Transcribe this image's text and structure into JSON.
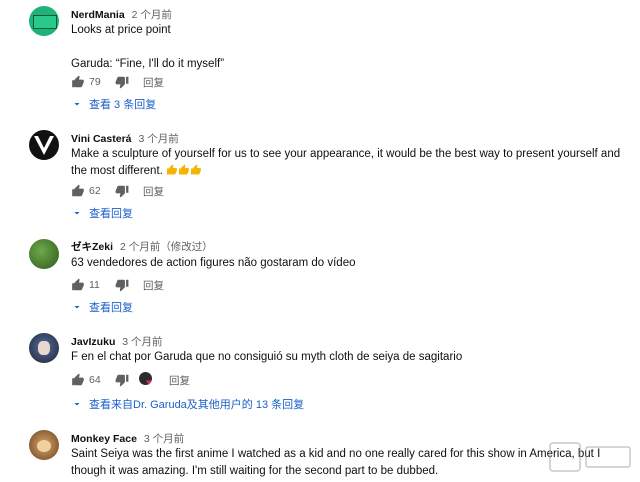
{
  "comments": [
    {
      "author": "NerdMania",
      "time": "2 个月前",
      "text": "Looks at price point\n\nGaruda: “Fine, I'll do it myself”",
      "likes": "79",
      "reply": "回复",
      "replies": "查看 3 条回复",
      "avatar_color": "#1fb37a"
    },
    {
      "author": "Vini Casterá",
      "time": "3 个月前",
      "text_main": "Make a sculpture of yourself for us to see your appearance, it would be the best way to present yourself and the most different.",
      "likes": "62",
      "reply": "回复",
      "replies": "查看回复",
      "avatar_color": "#111111"
    },
    {
      "author": "ゼキZeki",
      "time": "2 个月前（修改过）",
      "text": "63 vendedores de action figures não gostaram do vídeo",
      "likes": "11",
      "reply": "回复",
      "replies": "查看回复",
      "avatar_color": "#3f7a2d"
    },
    {
      "author": "JavIzuku",
      "time": "3 个月前",
      "text": "F en el chat por Garuda que no consiguió su myth cloth de seiya de sagitario",
      "likes": "64",
      "reply": "回复",
      "replies": "查看来自Dr. Garuda及其他用户的 13 条回复",
      "avatar_color": "#2a3550"
    },
    {
      "author": "Monkey Face",
      "time": "3 个月前",
      "text": "Saint Seiya was the first anime I watched as a kid and no one really cared for this show in America, but I though it was amazing. I'm still waiting for the second part to be dubbed.",
      "avatar_color": "#8a5a2b"
    }
  ],
  "colors": {
    "link_blue": "#1a60c8",
    "meta_gray": "#606060",
    "heart_red": "#e0245e"
  },
  "icons": [
    "thumb-up-icon",
    "thumb-down-icon",
    "chevron-down-icon",
    "heart-icon"
  ]
}
